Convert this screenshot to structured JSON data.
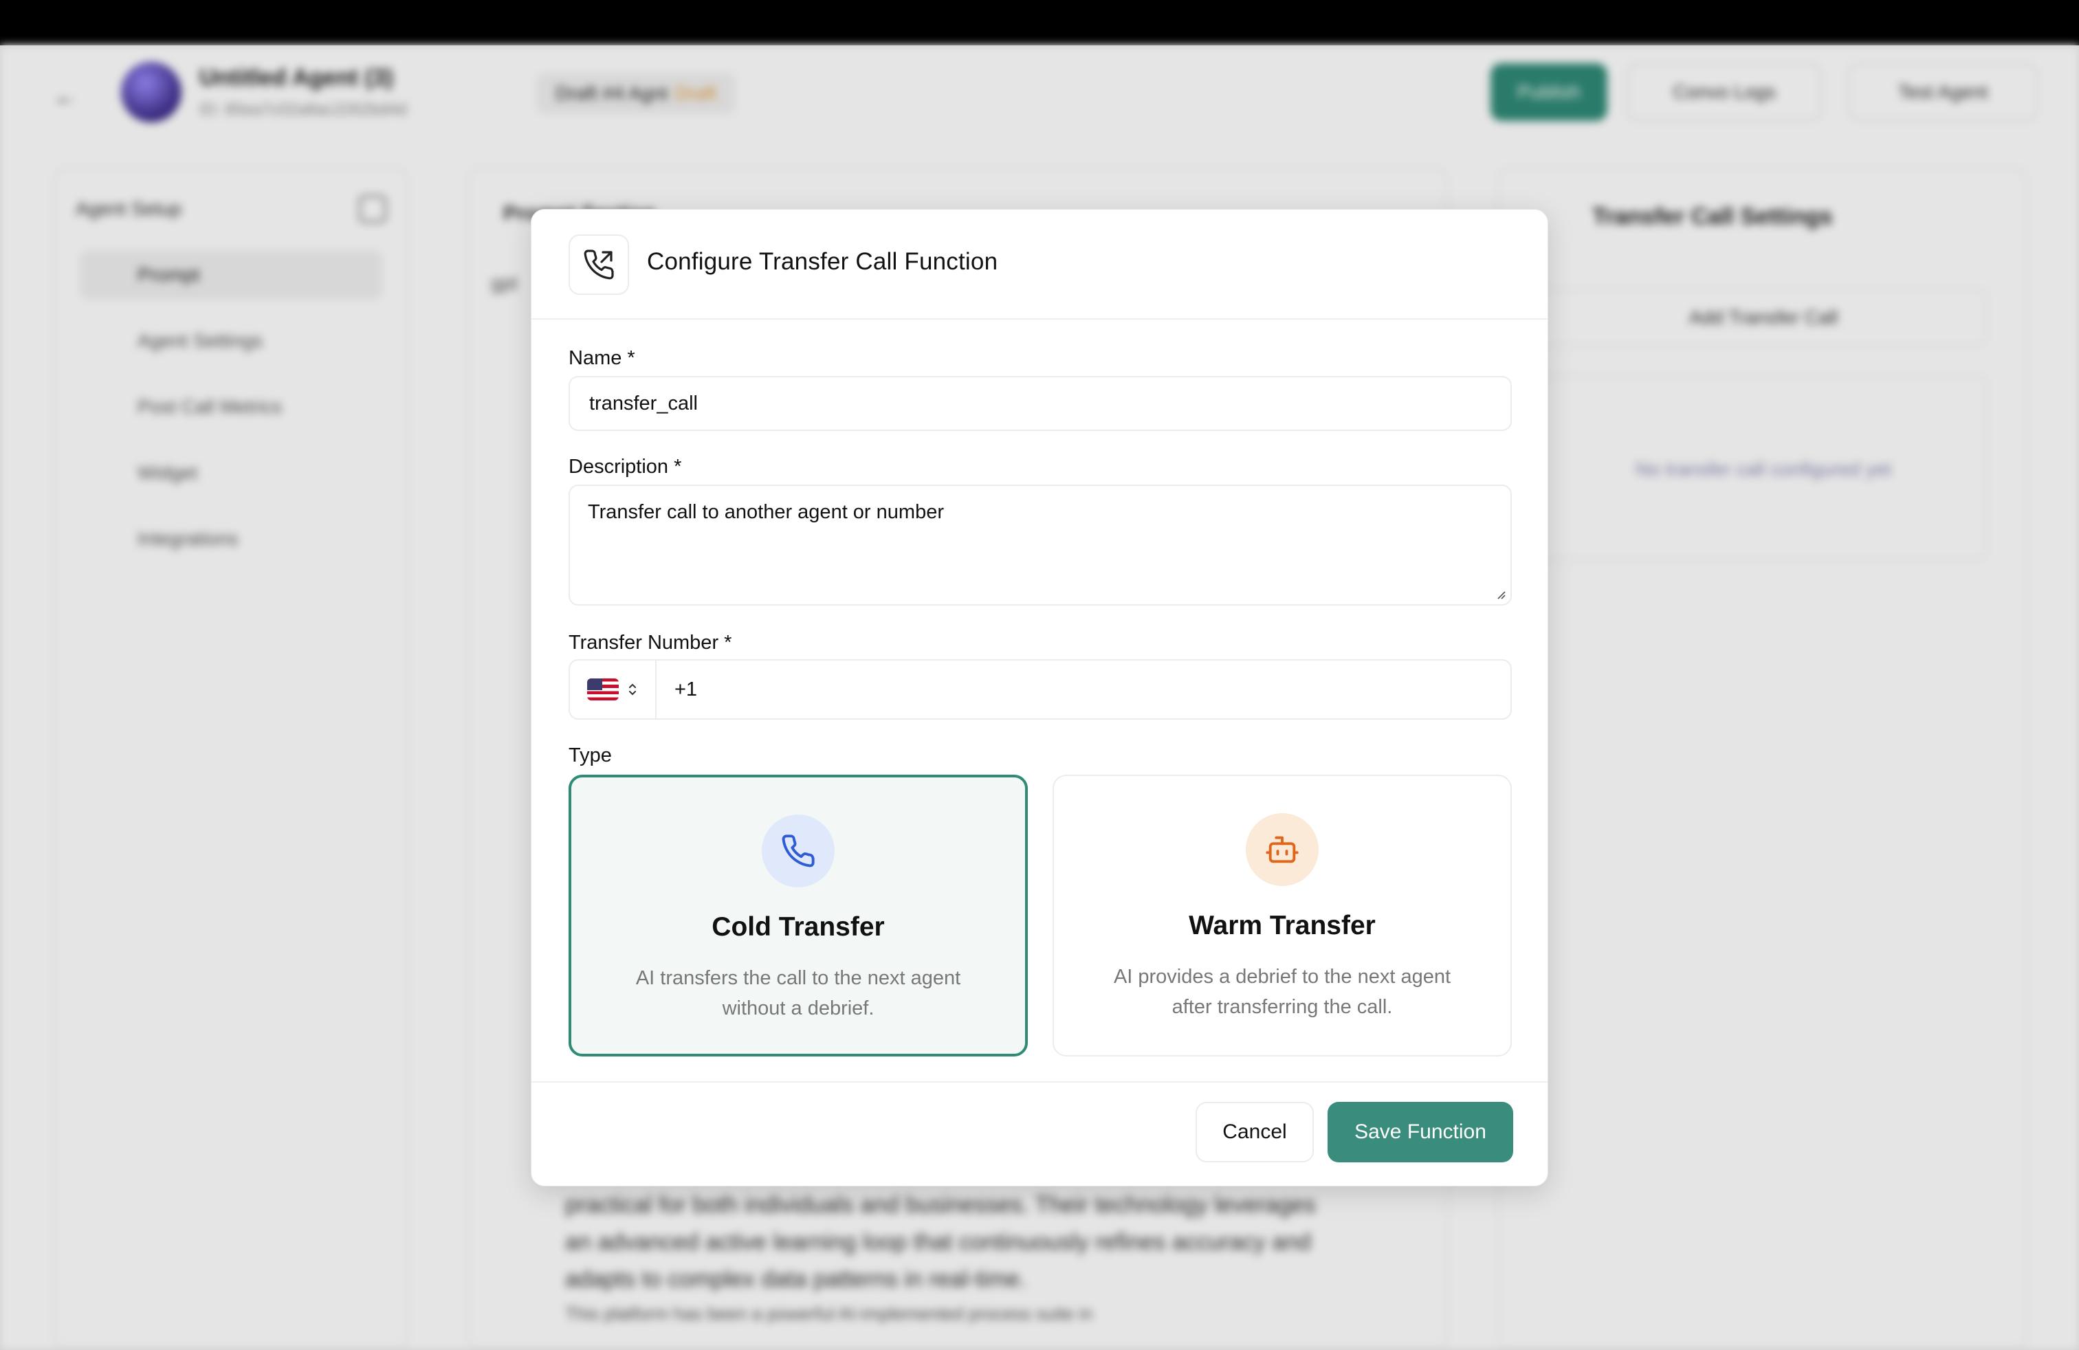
{
  "background": {
    "header": {
      "back_icon": "arrow-left-icon",
      "agent_name": "Untitled Agent (3)",
      "agent_id": "ID: 85ea7c02a8ac2262bd4d",
      "draft_label": "Draft #4 Agnt",
      "draft_tag": "Draft",
      "publish_label": "Publish",
      "convo_logs_label": "Convo Logs",
      "test_agent_label": "Test Agent"
    },
    "sidebar": {
      "title": "Agent Setup",
      "items": [
        {
          "label": "Prompt",
          "icon": "message-square-icon"
        },
        {
          "label": "Agent Settings",
          "icon": "settings-icon"
        },
        {
          "label": "Post Call Metrics",
          "icon": "chart-icon"
        },
        {
          "label": "Widget",
          "icon": "code-icon"
        },
        {
          "label": "Integrations",
          "icon": "plug-icon"
        }
      ]
    },
    "main": {
      "title": "Prompt Section",
      "prefix": "gpt",
      "text": "practical for both individuals and businesses. Their technology leverages an advanced active learning loop that continuously refines accuracy and adapts to complex data patterns in real-time.",
      "text_more": "This platform has been a powerful AI-implemented process suite in"
    },
    "right": {
      "title": "Transfer Call Settings",
      "add_label": "Add Transfer Call",
      "empty_label": "No transfer call configured yet"
    }
  },
  "modal": {
    "title": "Configure Transfer Call Function",
    "header_icon": "phone-forward-icon",
    "fields": {
      "name_label": "Name *",
      "name_value": "transfer_call",
      "description_label": "Description *",
      "description_value": "Transfer call to another agent or number",
      "transfer_number_label": "Transfer Number *",
      "country_flag": "us-flag-icon",
      "phone_value": "+1",
      "type_label": "Type"
    },
    "types": [
      {
        "title": "Cold Transfer",
        "description": "AI transfers the call to the next agent without a debrief.",
        "icon": "phone-icon",
        "selected": true,
        "icon_color": "#2f5bd3",
        "icon_bg": "#dfe9fb"
      },
      {
        "title": "Warm Transfer",
        "description": "AI provides a debrief to the next agent after transferring the call.",
        "icon": "bot-icon",
        "selected": false,
        "icon_color": "#e0661b",
        "icon_bg": "#fbead7"
      }
    ],
    "footer": {
      "cancel_label": "Cancel",
      "save_label": "Save Function"
    },
    "accent_color": "#3a8c7c"
  }
}
